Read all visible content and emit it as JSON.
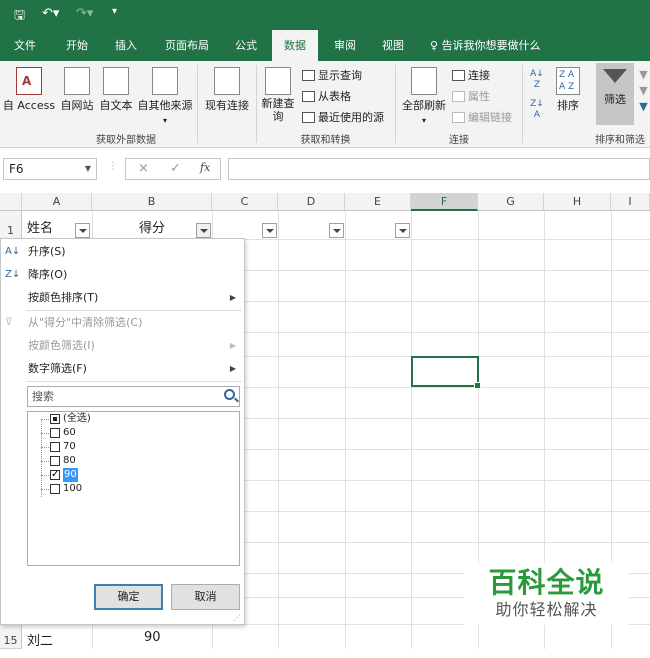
{
  "quick_access": {
    "save": "save-icon",
    "undo": "undo-icon",
    "redo": "redo-icon"
  },
  "tabs": [
    {
      "label": "文件"
    },
    {
      "label": "开始"
    },
    {
      "label": "插入"
    },
    {
      "label": "页面布局"
    },
    {
      "label": "公式"
    },
    {
      "label": "数据"
    },
    {
      "label": "审阅"
    },
    {
      "label": "视图"
    }
  ],
  "tell_me": "告诉我你想要做什么",
  "ribbon": {
    "get_external": {
      "buttons": [
        "自 Access",
        "自网站",
        "自文本",
        "自其他来源"
      ],
      "existing": "现有连接",
      "label": "获取外部数据"
    },
    "transform": {
      "new_query": "新建查询",
      "items": [
        "显示查询",
        "从表格",
        "最近使用的源"
      ],
      "label": "获取和转换"
    },
    "connections": {
      "refresh_all": "全部刷新",
      "items": [
        "连接",
        "属性",
        "编辑链接"
      ],
      "label": "连接"
    },
    "sort_filter": {
      "sort": "排序",
      "filter": "筛选",
      "label": "排序和筛选"
    }
  },
  "formula_bar": {
    "name_box": "F6",
    "fx": "fx",
    "cancel": "×",
    "enter": "✓"
  },
  "columns": [
    "A",
    "B",
    "C",
    "D",
    "E",
    "F",
    "G",
    "H",
    "I"
  ],
  "cells": {
    "a1": "姓名",
    "b1": "得分",
    "a15": "刘二",
    "b15": "90"
  },
  "rows": {
    "r1": "1",
    "r15": "15"
  },
  "dropdown": {
    "sort_asc": "升序(S)",
    "sort_desc": "降序(O)",
    "sort_color": "按颜色排序(T)",
    "clear_filter": "从\"得分\"中清除筛选(C)",
    "filter_color": "按颜色筛选(I)",
    "number_filter": "数字筛选(F)",
    "search_placeholder": "搜索",
    "items": [
      {
        "label": "(全选)",
        "state": "partial"
      },
      {
        "label": "60",
        "state": "unchecked"
      },
      {
        "label": "70",
        "state": "unchecked"
      },
      {
        "label": "80",
        "state": "unchecked"
      },
      {
        "label": "90",
        "state": "checked"
      },
      {
        "label": "100",
        "state": "unchecked"
      }
    ],
    "ok": "确定",
    "cancel": "取消"
  },
  "watermark": {
    "line1": "百科全说",
    "line2": "助你轻松解决"
  },
  "colors": {
    "accent": "#217346",
    "selection": "#3399ff"
  }
}
